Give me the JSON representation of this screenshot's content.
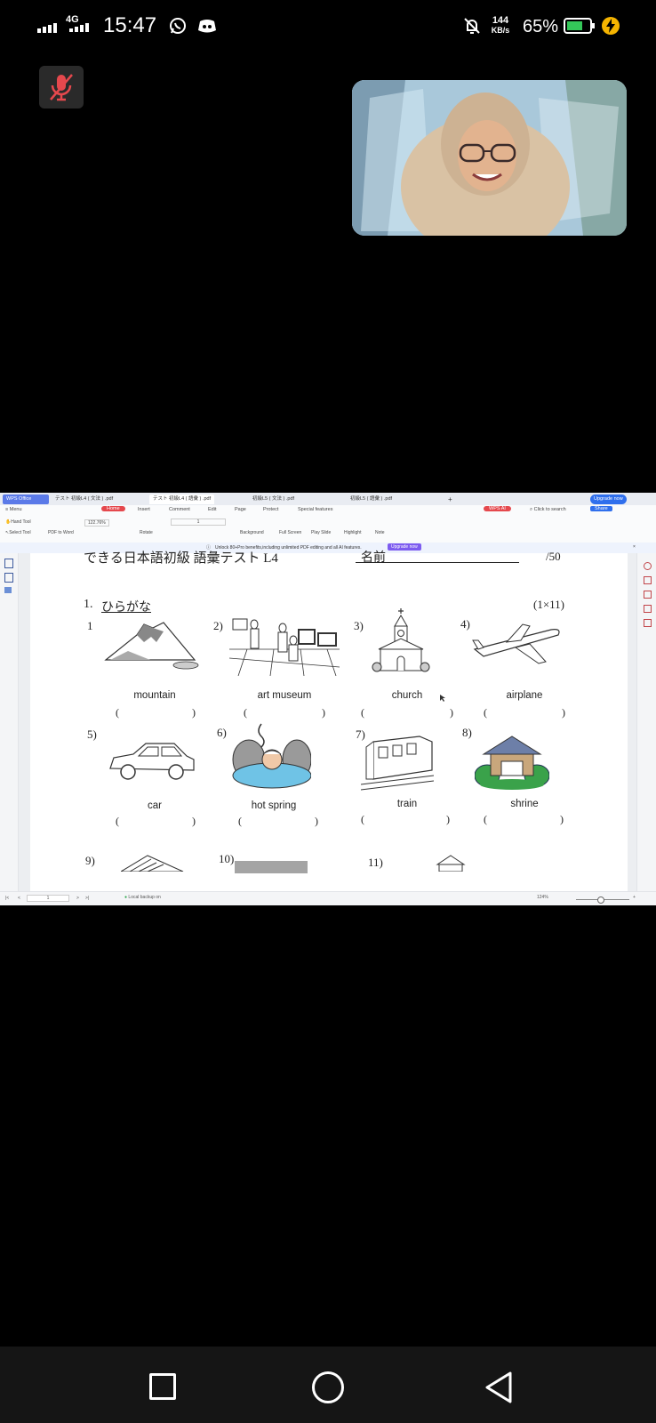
{
  "status_bar": {
    "network": "4G",
    "time": "15:47",
    "speed_value": "144",
    "speed_unit": "KB/s",
    "battery": "65%"
  },
  "meeting": {
    "mic_state": "muted"
  },
  "wps": {
    "tabs": [
      {
        "label": "WPS Office"
      },
      {
        "label": "テスト 初級L4 ( 文法 ) .pdf"
      },
      {
        "label": "テスト 初級L4 ( 語彙 ) .pdf"
      },
      {
        "label": "初級L5 ( 文法 ) .pdf"
      },
      {
        "label": "初級L5 ( 語彙 ) .pdf"
      },
      {
        "label": "+"
      }
    ],
    "upgrade_label": "Upgrade now",
    "menu": {
      "menu_label": "Menu",
      "items": [
        "Home",
        "Insert",
        "Comment",
        "Edit",
        "Page",
        "Protect",
        "Special features"
      ],
      "wps_ai": "WPS AI",
      "search": "Click to search",
      "share": "Share"
    },
    "toolbar": {
      "hand_tool": "Hand Tool",
      "select_tool": "Select Tool",
      "pdf_to_word": "PDF to Word",
      "zoom": "122.76%",
      "page_num": "1",
      "rotate": "Rotate",
      "background": "Background",
      "full_screen": "Full Screen",
      "play_slide": "Play Slide",
      "highlight": "Highlight",
      "note": "Note"
    },
    "banner": {
      "text": "Unlock 80+Pro benefits,including unlimited PDF editing and all AI features.",
      "button": "Upgrade now"
    },
    "bottom_bar": {
      "page": "1",
      "backup": "Local backup on",
      "zoom": "124%"
    }
  },
  "document": {
    "header_title": "できる日本語初級 語彙テスト L4",
    "name_label": "名前",
    "score": "/50",
    "section_number": "1.",
    "section_title": "ひらがな",
    "points": "(1×11)",
    "items": [
      {
        "num": "1",
        "label": "mountain"
      },
      {
        "num": "2)",
        "label": "art museum"
      },
      {
        "num": "3)",
        "label": "church"
      },
      {
        "num": "4)",
        "label": "airplane"
      },
      {
        "num": "5)",
        "label": "car"
      },
      {
        "num": "6)",
        "label": "hot spring"
      },
      {
        "num": "7)",
        "label": "train"
      },
      {
        "num": "8)",
        "label": "shrine"
      },
      {
        "num": "9)",
        "label": ""
      },
      {
        "num": "10)",
        "label": ""
      },
      {
        "num": "11)",
        "label": ""
      }
    ],
    "paren_open": "(",
    "paren_close": ")"
  },
  "colors": {
    "accent_red": "#e5484d",
    "accent_blue": "#2f6fed",
    "battery_green": "#34c759"
  }
}
